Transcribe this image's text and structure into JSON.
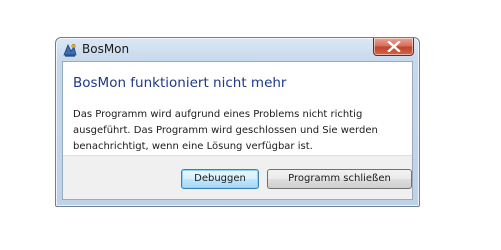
{
  "window": {
    "title": "BosMon",
    "close_icon": "close-icon",
    "app_icon": "bosmon-app-icon"
  },
  "dialog": {
    "heading": "BosMon funktioniert nicht mehr",
    "message_lines": [
      "Das Programm wird aufgrund eines Problems nicht richtig",
      "ausgeführt. Das Programm wird geschlossen und Sie werden",
      "benachrichtigt, wenn eine Lösung verfügbar ist."
    ]
  },
  "buttons": {
    "debug_label": "Debuggen",
    "close_program_label": "Programm schließen"
  },
  "colors": {
    "heading": "#1e3a87",
    "close_button": "#c2442d",
    "frame": "#c6d8ec"
  }
}
